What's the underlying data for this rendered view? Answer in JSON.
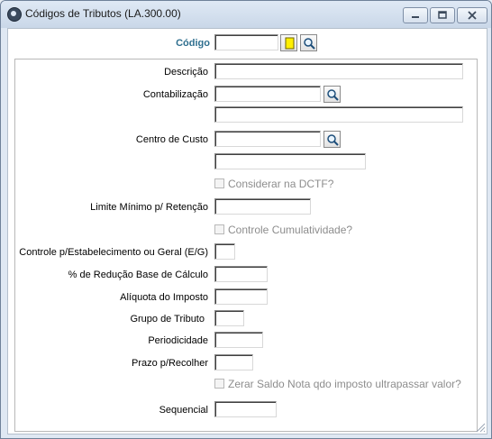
{
  "window": {
    "title": "Códigos de Tributos (LA.300.00)"
  },
  "labels": {
    "codigo": "Código",
    "descricao": "Descrição",
    "contabilizacao": "Contabilização",
    "centro_custo": "Centro de Custo",
    "limite_minimo": "Limite Mínimo p/ Retenção",
    "controle_estab": "Controle p/Estabelecimento ou Geral (E/G)",
    "perc_reducao": "% de Redução Base de Cálculo",
    "aliquota": "Alíquota do Imposto",
    "grupo_tributo": "Grupo de Tributo",
    "periodicidade": "Periodicidade",
    "prazo_recolher": "Prazo p/Recolher",
    "sequencial": "Sequencial"
  },
  "checkboxes": {
    "considerar_dctf": "Considerar na DCTF?",
    "controle_cumulatividade": "Controle Cumulatividade?",
    "zerar_saldo": "Zerar Saldo Nota qdo imposto ultrapassar valor?"
  },
  "icons": {
    "new_record": "note-icon",
    "search": "magnifier-icon"
  }
}
